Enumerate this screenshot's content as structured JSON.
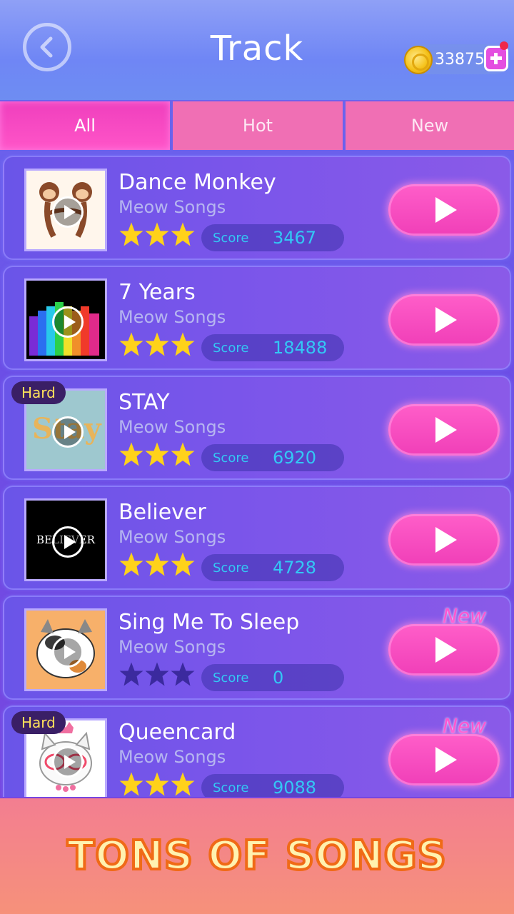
{
  "header": {
    "title": "Track",
    "coins": "33875"
  },
  "tabs": [
    {
      "label": "All"
    },
    {
      "label": "Hot"
    },
    {
      "label": "New"
    }
  ],
  "songs": [
    {
      "title": "Dance Monkey",
      "artist": "Meow Songs",
      "score_label": "Score",
      "score": "3467",
      "stars_earned": 3
    },
    {
      "title": "7 Years",
      "artist": "Meow Songs",
      "score_label": "Score",
      "score": "18488",
      "stars_earned": 3
    },
    {
      "title": "STAY",
      "artist": "Meow Songs",
      "score_label": "Score",
      "score": "6920",
      "stars_earned": 3,
      "badge": "Hard",
      "cover_text": "Stay"
    },
    {
      "title": "Believer",
      "artist": "Meow Songs",
      "score_label": "Score",
      "score": "4728",
      "stars_earned": 3,
      "cover_text": "BELIEVER"
    },
    {
      "title": "Sing Me To Sleep",
      "artist": "Meow Songs",
      "score_label": "Score",
      "score": "0",
      "stars_earned": 0,
      "new_label": "New"
    },
    {
      "title": "Queencard",
      "artist": "Meow Songs",
      "score_label": "Score",
      "score": "9088",
      "stars_earned": 3,
      "badge": "Hard",
      "new_label": "New"
    }
  ],
  "footer": {
    "banner": "TONS OF SONGS"
  },
  "colors": {
    "accent_pink": "#f03fb8",
    "star_gold": "#ffd21a",
    "star_empty": "#3b2a9e",
    "score_blue": "#33c8f5",
    "hard_text": "#ffe15a"
  }
}
